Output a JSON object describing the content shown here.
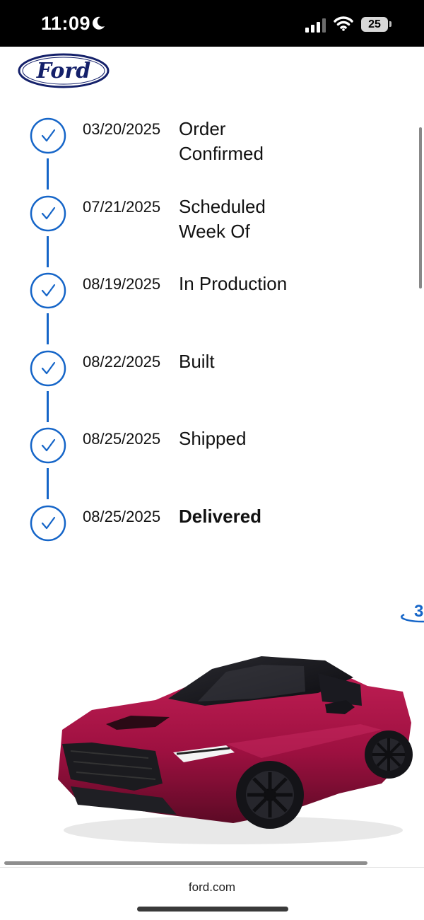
{
  "status_bar": {
    "time": "11:09",
    "battery_level": "25"
  },
  "brand": {
    "logo_text": "Ford",
    "accent_color": "#1565c8"
  },
  "timeline": {
    "steps": [
      {
        "date": "03/20/2025",
        "label": "Order Confirmed",
        "completed": true
      },
      {
        "date": "07/21/2025",
        "label": "Scheduled Week Of",
        "completed": true
      },
      {
        "date": "08/19/2025",
        "label": "In Production",
        "completed": true
      },
      {
        "date": "08/22/2025",
        "label": "Built",
        "completed": true
      },
      {
        "date": "08/25/2025",
        "label": "Shipped",
        "completed": true
      },
      {
        "date": "08/25/2025",
        "label": "Delivered",
        "completed": true,
        "emphasis": "bold"
      }
    ]
  },
  "viewer": {
    "badge_text": "3"
  },
  "browser": {
    "url": "ford.com"
  }
}
